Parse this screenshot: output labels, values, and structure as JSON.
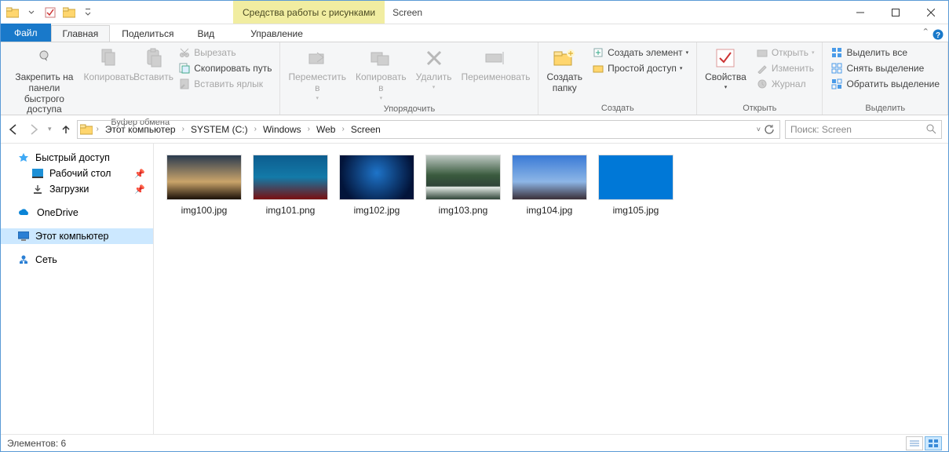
{
  "title_context": "Средства работы с рисунками",
  "window_title": "Screen",
  "tabs": {
    "file": "Файл",
    "home": "Главная",
    "share": "Поделиться",
    "view": "Вид",
    "manage": "Управление"
  },
  "ribbon": {
    "clipboard": {
      "pin": "Закрепить на панели\nбыстрого доступа",
      "copy": "Копировать",
      "paste": "Вставить",
      "cut": "Вырезать",
      "copypath": "Скопировать путь",
      "paste_shortcut": "Вставить ярлык",
      "group": "Буфер обмена"
    },
    "organise": {
      "moveto": "Переместить\nв",
      "copyto": "Копировать\nв",
      "delete": "Удалить",
      "rename": "Переименовать",
      "group": "Упорядочить"
    },
    "new": {
      "newfolder": "Создать\nпапку",
      "newitem": "Создать элемент",
      "easyaccess": "Простой доступ",
      "group": "Создать"
    },
    "open": {
      "properties": "Свойства",
      "open": "Открыть",
      "edit": "Изменить",
      "history": "Журнал",
      "group": "Открыть"
    },
    "select": {
      "selectall": "Выделить все",
      "selectnone": "Снять выделение",
      "invert": "Обратить выделение",
      "group": "Выделить"
    }
  },
  "breadcrumbs": [
    "Этот компьютер",
    "SYSTEM (C:)",
    "Windows",
    "Web",
    "Screen"
  ],
  "search_placeholder": "Поиск: Screen",
  "nav": {
    "quick": "Быстрый доступ",
    "desktop": "Рабочий стол",
    "downloads": "Загрузки",
    "onedrive": "OneDrive",
    "thispc": "Этот компьютер",
    "network": "Сеть"
  },
  "files": [
    {
      "name": "img100.jpg",
      "bg": "linear-gradient(180deg,#2a3b4f 0%,#caa46a 60%,#1a1008 100%)"
    },
    {
      "name": "img101.png",
      "bg": "linear-gradient(180deg,#0d5d8f 0%,#137aa8 50%,#7a0f10 100%)"
    },
    {
      "name": "img102.jpg",
      "bg": "radial-gradient(circle at 50% 40%,#1e74c9,#02143a 80%)"
    },
    {
      "name": "img103.png",
      "bg": "linear-gradient(180deg,#bfc9c4 0%,#3a5b3e 45%,#2f4438 70%,#e6ede8 72%,#2f4438 100%)"
    },
    {
      "name": "img104.jpg",
      "bg": "linear-gradient(180deg,#3a7ad6 0%,#8db6e6 60%,#3a2f38 100%)"
    },
    {
      "name": "img105.jpg",
      "bg": "#0078d7"
    }
  ],
  "status": "Элементов: 6"
}
